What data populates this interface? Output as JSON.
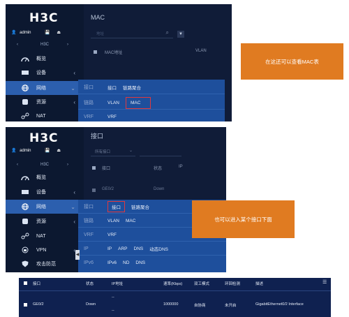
{
  "brand": {
    "logo": "H3C",
    "logo_small": "H3C",
    "user": "admin"
  },
  "shot1": {
    "title": "MAC",
    "search_placeholder": "地址",
    "columns": [
      "MAC地址",
      "VLAN"
    ],
    "nav": [
      {
        "label": "概览",
        "icon": "dashboard-icon"
      },
      {
        "label": "设备",
        "icon": "device-icon",
        "chev": "‹"
      },
      {
        "label": "网络",
        "icon": "globe-icon",
        "chev": "⌄"
      },
      {
        "label": "资源",
        "icon": "database-icon",
        "chev": "‹"
      },
      {
        "label": "NAT",
        "icon": "nat-icon"
      }
    ],
    "menu": [
      {
        "cat": "接口",
        "items": [
          "接口",
          "链路聚合"
        ]
      },
      {
        "cat": "链路",
        "items": [
          "VLAN",
          "MAC"
        ]
      },
      {
        "cat": "VRF",
        "items": [
          "VRF"
        ]
      }
    ],
    "callout": "在这还可以查看MAC表"
  },
  "shot2": {
    "title": "接口",
    "filter_label": "所有接口",
    "columns": [
      "接口",
      "状态",
      "IP"
    ],
    "row": {
      "name": "GE0/2",
      "status": "Down"
    },
    "nav": [
      {
        "label": "概览",
        "icon": "dashboard-icon"
      },
      {
        "label": "设备",
        "icon": "device-icon",
        "chev": "‹"
      },
      {
        "label": "网络",
        "icon": "globe-icon",
        "chev": "⌄"
      },
      {
        "label": "资源",
        "icon": "database-icon",
        "chev": "‹"
      },
      {
        "label": "NAT",
        "icon": "nat-icon"
      },
      {
        "label": "VPN",
        "icon": "vpn-icon",
        "chev": "‹"
      },
      {
        "label": "攻击防范",
        "icon": "shield-icon"
      }
    ],
    "menu": [
      {
        "cat": "接口",
        "items": [
          "接口",
          "链路聚合"
        ]
      },
      {
        "cat": "链路",
        "items": [
          "VLAN",
          "MAC"
        ]
      },
      {
        "cat": "VRF",
        "items": [
          "VRF"
        ]
      },
      {
        "cat": "IP",
        "items": [
          "IP",
          "ARP",
          "DNS",
          "动态DNS"
        ]
      },
      {
        "cat": "IPv6",
        "items": [
          "IPv6",
          "ND",
          "DNS"
        ]
      }
    ],
    "callout": "也可以进入某个接口下面"
  },
  "table": {
    "headers": [
      "接口",
      "状态",
      "IP地址",
      "速率(Kbps)",
      "双工模式",
      "环回检测",
      "描述"
    ],
    "row": {
      "iface": "GE0/2",
      "status": "Down",
      "ip": "--",
      "ip2": "--",
      "speed": "1000000",
      "duplex": "自协商",
      "loop": "未开启",
      "desc": "GigabitEthernet0/2 Interface"
    }
  }
}
